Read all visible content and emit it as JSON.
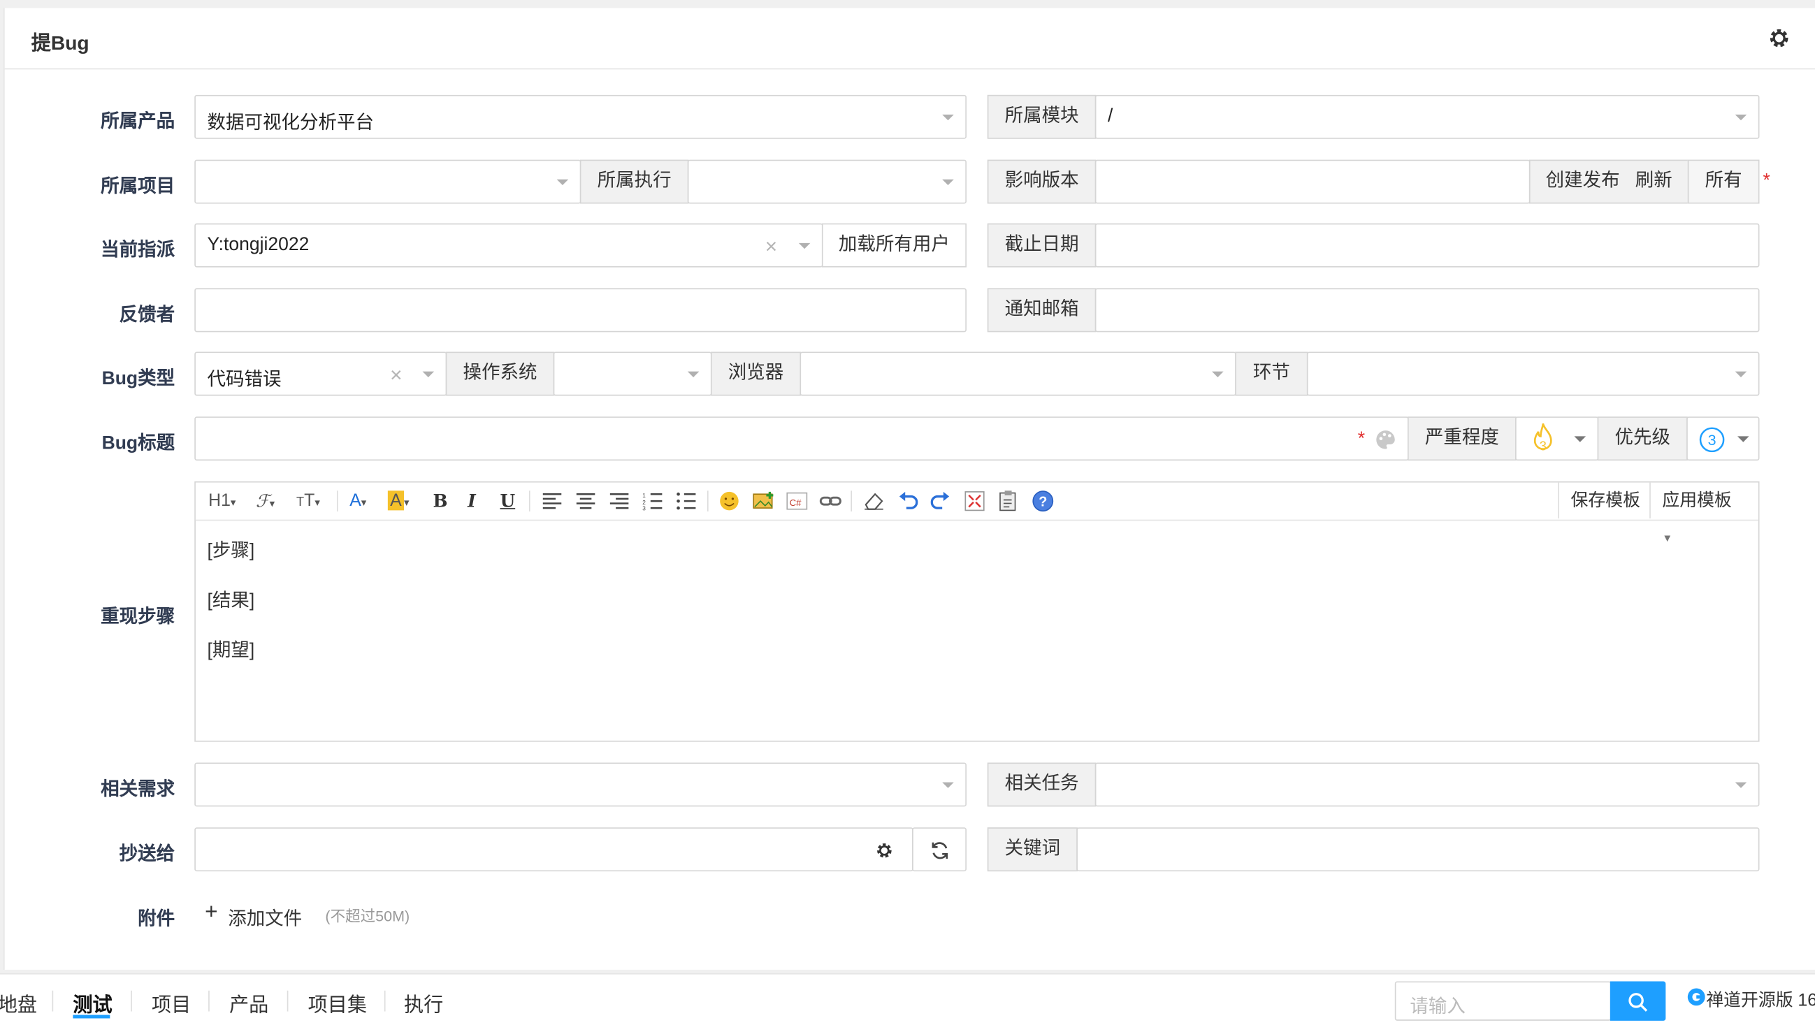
{
  "panel": {
    "title": "提Bug"
  },
  "form": {
    "product_label": "所属产品",
    "product_value": "数据可视化分析平台",
    "module_label": "所属模块",
    "module_value": "/",
    "project_label": "所属项目",
    "execution_label": "所属执行",
    "version_label": "影响版本",
    "create_release": "创建发布",
    "refresh": "刷新",
    "all": "所有",
    "assign_label": "当前指派",
    "assign_value": "Y:tongji2022",
    "load_all_users": "加载所有用户",
    "deadline_label": "截止日期",
    "feedback_label": "反馈者",
    "notify_label": "通知邮箱",
    "bugtype_label": "Bug类型",
    "bugtype_value": "代码错误",
    "os_label": "操作系统",
    "browser_label": "浏览器",
    "stage_label": "环节",
    "title_label": "Bug标题",
    "severity_label": "严重程度",
    "severity_value": "3",
    "priority_label": "优先级",
    "priority_value": "3",
    "steps_label": "重现步骤",
    "save_template": "保存模板",
    "apply_template": "应用模板",
    "steps_lines": [
      "[步骤]",
      "[结果]",
      "[期望]"
    ],
    "story_label": "相关需求",
    "task_label": "相关任务",
    "cc_label": "抄送给",
    "keywords_label": "关键词",
    "attach_label": "附件",
    "add_file": "添加文件",
    "file_limit": "(不超过50M)",
    "required_mark": "*"
  },
  "toolbar": {
    "icons": [
      "heading-icon",
      "font-family-icon",
      "font-size-icon",
      "font-color-icon",
      "highlight-icon",
      "bold-icon",
      "italic-icon",
      "underline-icon",
      "align-left-icon",
      "align-center-icon",
      "align-right-icon",
      "ordered-list-icon",
      "unordered-list-icon",
      "emoticon-icon",
      "image-icon",
      "code-icon",
      "link-icon",
      "eraser-icon",
      "undo-icon",
      "redo-icon",
      "fullscreen-icon",
      "paste-icon",
      "help-icon"
    ]
  },
  "bottom": {
    "nav": [
      "地盘",
      "测试",
      "项目",
      "产品",
      "项目集",
      "执行"
    ],
    "active": "测试",
    "search_placeholder": "请输入",
    "brand": "禅道开源版 16"
  },
  "colors": {
    "primary": "#1e9fff",
    "required": "#e02e2e",
    "fire": "#f5c12a"
  }
}
